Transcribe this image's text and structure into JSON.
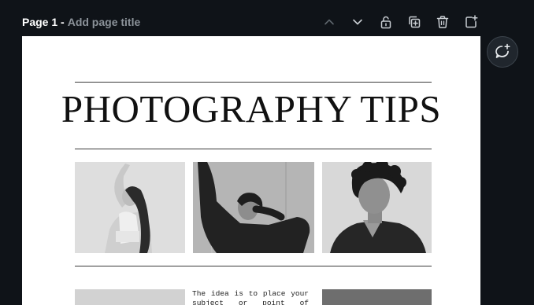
{
  "header": {
    "page_label": "Page 1 -",
    "title_placeholder": "Add page title"
  },
  "toolbar": {
    "icons": [
      "chevron-up-icon",
      "chevron-down-icon",
      "lock-icon",
      "duplicate-page-icon",
      "trash-icon",
      "add-page-icon"
    ]
  },
  "comment": {
    "icon": "add-comment-icon"
  },
  "document": {
    "title": "PHOTOGRAPHY TIPS",
    "body_text": "The idea is to place your subject or point of interest at"
  },
  "colors": {
    "app_background": "#0f1318",
    "canvas_background": "#ffffff",
    "muted_text": "#8b9299",
    "icon_color": "#c9ced3",
    "disabled_icon_color": "#5d656c"
  }
}
